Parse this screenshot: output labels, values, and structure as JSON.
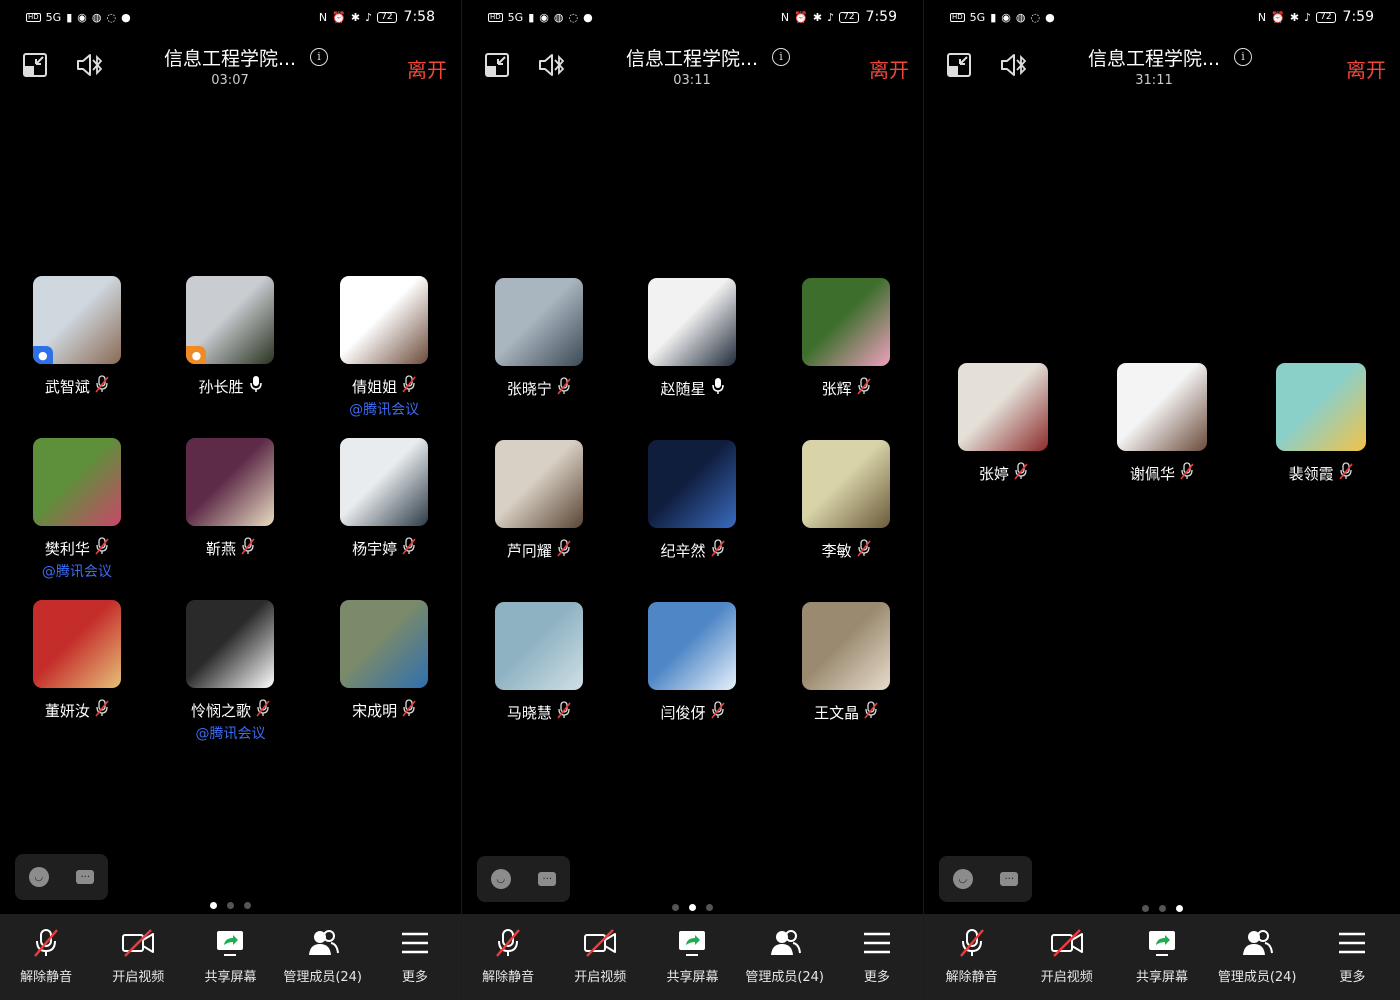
{
  "screens": [
    {
      "status": {
        "time": "7:58",
        "battery": "72",
        "network": "5G"
      },
      "header": {
        "title": "信息工程学院...",
        "duration": "03:07",
        "leave": "离开",
        "info": "i"
      },
      "participants": [
        {
          "name": "武智斌",
          "mic": "muted",
          "tag": "",
          "badge": "blue",
          "colors": [
            "#cfd7df",
            "#8a6a54"
          ]
        },
        {
          "name": "孙长胜",
          "mic": "on",
          "tag": "",
          "badge": "orange",
          "colors": [
            "#c9ccd1",
            "#2a3320"
          ]
        },
        {
          "name": "倩姐姐",
          "mic": "muted",
          "tag": "@腾讯会议",
          "badge": "",
          "colors": [
            "#ffffff",
            "#6b4a3a"
          ]
        },
        {
          "name": "樊利华",
          "mic": "muted",
          "tag": "@腾讯会议",
          "badge": "",
          "colors": [
            "#5e8f3a",
            "#c8486b"
          ]
        },
        {
          "name": "靳燕",
          "mic": "muted",
          "tag": "",
          "badge": "",
          "colors": [
            "#5d2a48",
            "#e8dcc0"
          ]
        },
        {
          "name": "杨宇婷",
          "mic": "muted",
          "tag": "",
          "badge": "",
          "colors": [
            "#e8ecef",
            "#2d3a46"
          ]
        },
        {
          "name": "董妍汝",
          "mic": "muted",
          "tag": "",
          "badge": "",
          "colors": [
            "#c42d2a",
            "#e6c07a"
          ]
        },
        {
          "name": "怜悯之歌",
          "mic": "muted",
          "tag": "@腾讯会议",
          "badge": "",
          "colors": [
            "#2a2a2a",
            "#ffffff"
          ]
        },
        {
          "name": "宋成明",
          "mic": "muted",
          "tag": "",
          "badge": "",
          "colors": [
            "#7a8a6a",
            "#2f6fb0"
          ]
        }
      ],
      "tools": {
        "emoji": "emoji-icon",
        "chat": "chat-icon"
      },
      "pager": {
        "pages": 3,
        "active": 0
      }
    },
    {
      "status": {
        "time": "7:59",
        "battery": "72",
        "network": "5G"
      },
      "header": {
        "title": "信息工程学院...",
        "duration": "03:11",
        "leave": "离开",
        "info": "i"
      },
      "participants": [
        {
          "name": "张晓宁",
          "mic": "muted",
          "tag": "",
          "badge": "",
          "colors": [
            "#a9b5bf",
            "#3c4a55"
          ]
        },
        {
          "name": "赵随星",
          "mic": "on",
          "tag": "",
          "badge": "",
          "colors": [
            "#f2f2f2",
            "#1f2b3a"
          ]
        },
        {
          "name": "张辉",
          "mic": "muted",
          "tag": "",
          "badge": "",
          "colors": [
            "#3d6e2c",
            "#f0a0c0"
          ]
        },
        {
          "name": "芦冋耀",
          "mic": "muted",
          "tag": "",
          "badge": "",
          "colors": [
            "#d8d0c4",
            "#5a4433"
          ]
        },
        {
          "name": "纪辛然",
          "mic": "muted",
          "tag": "",
          "badge": "",
          "colors": [
            "#0f1e3d",
            "#3a6bc0"
          ]
        },
        {
          "name": "李敏",
          "mic": "muted",
          "tag": "",
          "badge": "",
          "colors": [
            "#d8d4a8",
            "#6b5a3a"
          ]
        },
        {
          "name": "马晓慧",
          "mic": "muted",
          "tag": "",
          "badge": "",
          "colors": [
            "#8fb2c2",
            "#cfe0e6"
          ]
        },
        {
          "name": "闫俊伢",
          "mic": "muted",
          "tag": "",
          "badge": "",
          "colors": [
            "#4f86c6",
            "#e8f1fb"
          ]
        },
        {
          "name": "王文晶",
          "mic": "muted",
          "tag": "",
          "badge": "",
          "colors": [
            "#9a8a70",
            "#e8dccb"
          ]
        }
      ],
      "tools": {
        "emoji": "emoji-icon",
        "chat": "chat-icon"
      },
      "pager": {
        "pages": 3,
        "active": 1
      }
    },
    {
      "status": {
        "time": "7:59",
        "battery": "72",
        "network": "5G"
      },
      "header": {
        "title": "信息工程学院...",
        "duration": "31:11",
        "leave": "离开",
        "info": "i"
      },
      "participants": [
        {
          "name": "张婷",
          "mic": "muted",
          "tag": "",
          "badge": "",
          "colors": [
            "#e4e0d8",
            "#8a2a2a"
          ]
        },
        {
          "name": "谢佩华",
          "mic": "muted",
          "tag": "",
          "badge": "",
          "colors": [
            "#f4f4f4",
            "#6a4a3a"
          ]
        },
        {
          "name": "裴领霞",
          "mic": "muted",
          "tag": "",
          "badge": "",
          "colors": [
            "#8ad0c8",
            "#f2c24a"
          ]
        }
      ],
      "tools": {
        "emoji": "emoji-icon",
        "chat": "chat-icon"
      },
      "pager": {
        "pages": 3,
        "active": 2
      }
    }
  ],
  "toolbar": [
    {
      "label": "解除静音",
      "icon": "mic-muted-icon"
    },
    {
      "label": "开启视频",
      "icon": "video-off-icon"
    },
    {
      "label": "共享屏幕",
      "icon": "share-screen-icon"
    },
    {
      "label": "管理成员(24)",
      "icon": "members-icon"
    },
    {
      "label": "更多",
      "icon": "menu-icon"
    }
  ],
  "colors": {
    "leave": "#f0473b",
    "tag": "#3c6cf0",
    "toolbar_bg": "#1f1f1f",
    "background": "#000000"
  }
}
